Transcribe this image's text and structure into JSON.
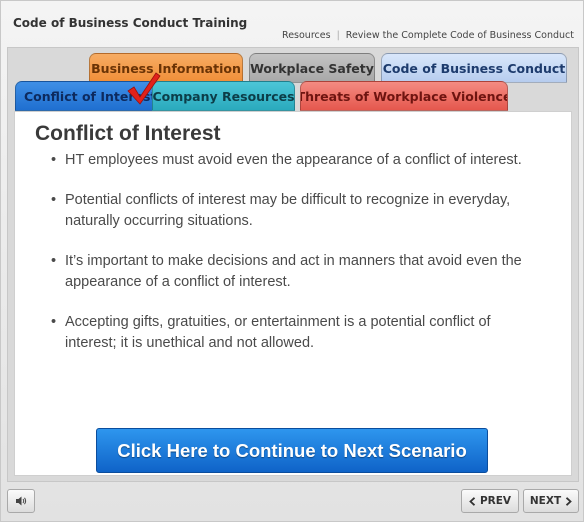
{
  "app": {
    "title": "Code of Business Conduct Training"
  },
  "header_links": [
    {
      "label": "Resources"
    },
    {
      "label": "Review the Complete Code of Business Conduct"
    }
  ],
  "tabs": {
    "business_information": "Business Information",
    "workplace_safety": "Workplace Safety",
    "code_of_business_conduct": "Code of Business Conduct",
    "conflict_of_interest": "Conflict of Interest",
    "company_resources": "Company Resources",
    "threats_of_workplace_violence": "Threats of Workplace Violence"
  },
  "tab_colors": {
    "business_information": "#f08e38",
    "workplace_safety": "#a8a8a8",
    "code_of_business_conduct": "#b6ccee",
    "conflict_of_interest": "#1f6fd0",
    "company_resources": "#2aaabd",
    "threats_of_workplace_violence": "#e5574d"
  },
  "completed_marker": {
    "icon": "red-checkmark-icon",
    "color": "#e0211b",
    "on_tab": "conflict_of_interest"
  },
  "content": {
    "title": "Conflict of Interest",
    "bullets": [
      "HT employees must avoid even the appearance of a conflict of interest.",
      "Potential conflicts of interest may be difficult to recognize in everyday, naturally occurring situations.",
      "It’s important to make decisions and act in manners that avoid even the appearance of a conflict of interest.",
      "Accepting gifts, gratuities, or entertainment is a potential conflict of interest; it is unethical and not allowed."
    ],
    "cta_label": "Click Here to Continue to Next Scenario"
  },
  "footer": {
    "audio_icon": "speaker-icon",
    "prev_label": "PREV",
    "next_label": "NEXT"
  }
}
